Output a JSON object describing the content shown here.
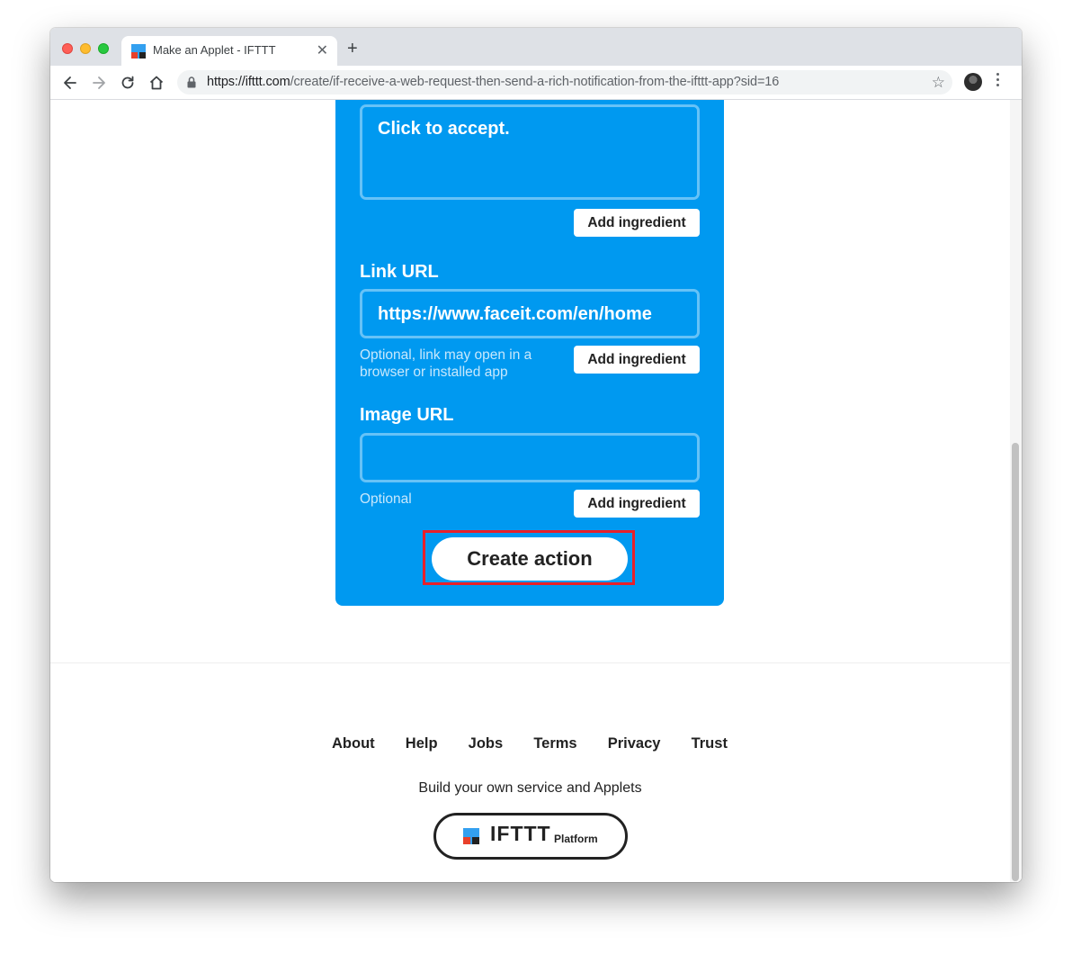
{
  "browser": {
    "tab_title": "Make an Applet - IFTTT",
    "tab_close": "✕",
    "new_tab": "+",
    "url_host": "https://ifttt.com",
    "url_path": "/create/if-receive-a-web-request-then-send-a-rich-notification-from-the-ifttt-app?sid=16",
    "star": "☆"
  },
  "form": {
    "message_value": "Click to accept.",
    "add_ingredient": "Add ingredient",
    "link_label": "Link URL",
    "link_value": "https://www.faceit.com/en/home",
    "link_helper": "Optional, link may open in a browser or installed app",
    "image_label": "Image URL",
    "image_value": "",
    "image_helper": "Optional",
    "create_action": "Create action"
  },
  "footer": {
    "links": [
      "About",
      "Help",
      "Jobs",
      "Terms",
      "Privacy",
      "Trust"
    ],
    "tagline": "Build your own service and Applets",
    "platform_word": "IFTTT",
    "platform_sub": "Platform"
  },
  "colors": {
    "accent": "#0099f0",
    "highlight": "#e8202a"
  },
  "icons": [
    "back-icon",
    "forward-icon",
    "reload-icon",
    "home-icon",
    "lock-icon",
    "star-icon",
    "menu-icon",
    "ifttt-logo-icon"
  ]
}
